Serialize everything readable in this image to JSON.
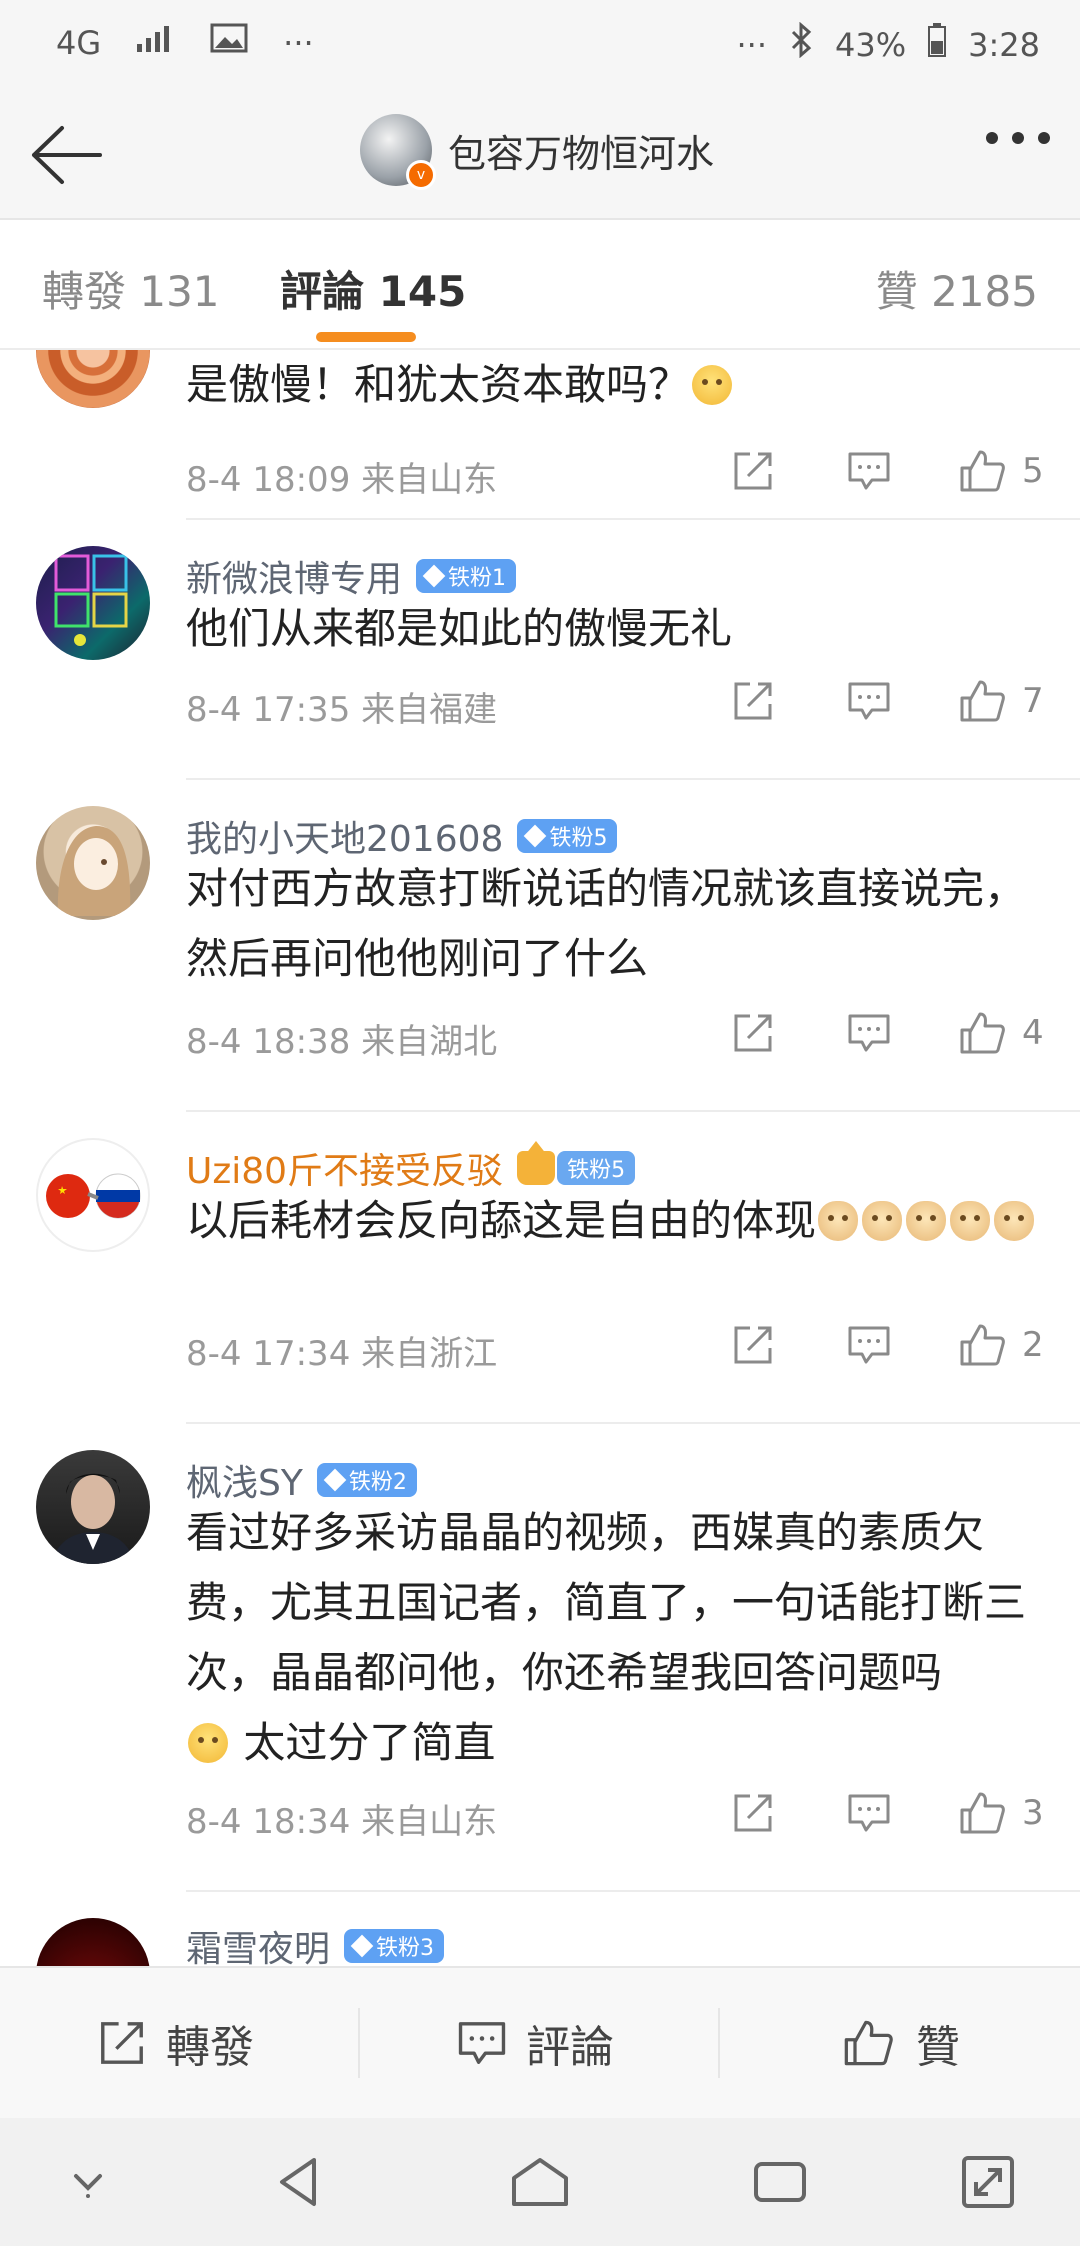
{
  "status_bar": {
    "network": "4G",
    "battery": "43%",
    "time": "3:28",
    "dots_left": "···",
    "dots_right": "···"
  },
  "header": {
    "title": "包容万物恒河水"
  },
  "tabs": [
    {
      "label": "轉發 131"
    },
    {
      "label": "評論 145"
    },
    {
      "label": "贊 2185"
    }
  ],
  "comments": [
    {
      "name": "",
      "badge": "",
      "text": "是傲慢！和犹太资本敢吗？",
      "meta": "8-4 18:09  来自山东",
      "likes": "5"
    },
    {
      "name": "新微浪博专用",
      "badge": "铁粉1",
      "text": "他们从来都是如此的傲慢无礼",
      "meta": "8-4 17:35  来自福建",
      "likes": "7"
    },
    {
      "name": "我的小天地201608",
      "badge": "铁粉5",
      "text": "对付西方故意打断说话的情况就该直接说完，然后再问他他刚问了什么",
      "meta": "8-4 18:38  来自湖北",
      "likes": "4"
    },
    {
      "name": "Uzi80斤不接受反驳",
      "badge": "铁粉5",
      "text": "以后耗材会反向舔这是自由的体现",
      "meta": "8-4 17:34  来自浙江",
      "likes": "2"
    },
    {
      "name": "枫浅SY",
      "badge": "铁粉2",
      "text": "看过好多采访晶晶的视频，西媒真的素质欠费，尤其丑国记者，简直了，一句话能打断三次，晶晶都问他，你还希望我回答问题吗",
      "text2": "太过分了简直",
      "meta": "8-4 18:34  来自山东",
      "likes": "3"
    },
    {
      "name": "霜雪夜明",
      "badge": "铁粉3"
    }
  ],
  "bottom_actions": {
    "repost": "轉發",
    "comment": "評論",
    "like": "贊"
  },
  "colors": {
    "accent": "#f58d1f",
    "badge": "#5ea1f3",
    "vip_name": "#e07b16"
  }
}
